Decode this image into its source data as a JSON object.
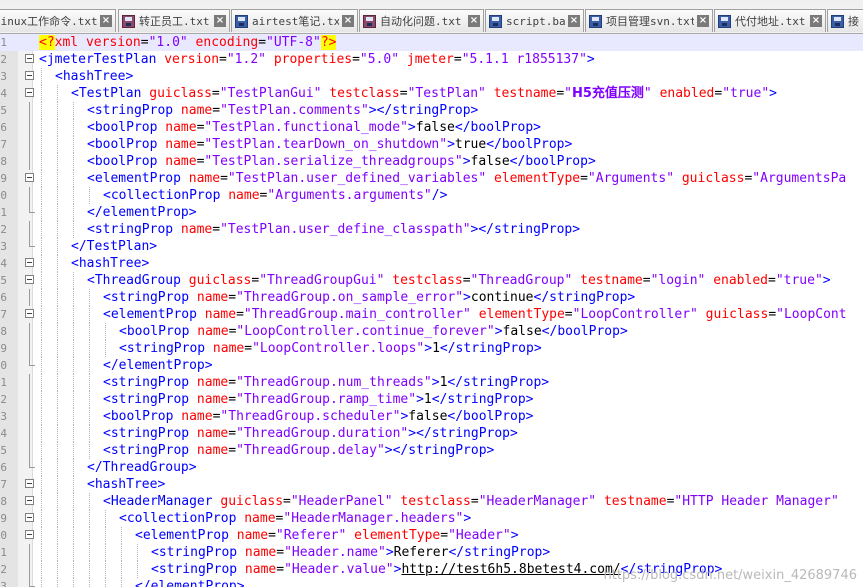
{
  "tabs": [
    {
      "label": "linux工作命令.txt",
      "modified": false
    },
    {
      "label": "转正员工.txt",
      "modified": true
    },
    {
      "label": "airtest笔记.txt",
      "modified": false
    },
    {
      "label": "自动化问题.txt",
      "modified": true
    },
    {
      "label": "script.bat",
      "modified": false
    },
    {
      "label": "项目管理svn.txt",
      "modified": false
    },
    {
      "label": "代付地址.txt",
      "modified": false
    },
    {
      "label": "接",
      "modified": false
    }
  ],
  "line_numbers": [
    "1",
    "2",
    "3",
    "4",
    "5",
    "6",
    "7",
    "8",
    "9",
    "0",
    "1",
    "2",
    "3",
    "4",
    "5",
    "6",
    "7",
    "8",
    "9",
    "0",
    "1",
    "2",
    "3",
    "4",
    "5",
    "6",
    "7",
    "8",
    "9",
    "0",
    "1",
    "2",
    "3"
  ],
  "fold_markers": [
    "none",
    "box",
    "box",
    "box",
    "line",
    "line",
    "line",
    "line",
    "box",
    "line",
    "end",
    "line",
    "end",
    "box",
    "box",
    "line",
    "box",
    "line",
    "line",
    "end",
    "line",
    "line",
    "line",
    "line",
    "line",
    "end",
    "box",
    "box",
    "box",
    "box",
    "line",
    "line",
    "end"
  ],
  "lines": [
    {
      "indent": 0,
      "tokens": [
        [
          "pi",
          "<?"
        ],
        [
          "pi-name",
          "xml"
        ],
        [
          "attr",
          " version"
        ],
        [
          "text",
          "="
        ],
        [
          "val",
          "\"1.0\""
        ],
        [
          "attr",
          " encoding"
        ],
        [
          "text",
          "="
        ],
        [
          "val",
          "\"UTF-8\""
        ],
        [
          "pi",
          "?>"
        ]
      ]
    },
    {
      "indent": 0,
      "tokens": [
        [
          "tag",
          "<jmeterTestPlan"
        ],
        [
          "attr",
          " version"
        ],
        [
          "text",
          "="
        ],
        [
          "val",
          "\"1.2\""
        ],
        [
          "attr",
          " properties"
        ],
        [
          "text",
          "="
        ],
        [
          "val",
          "\"5.0\""
        ],
        [
          "attr",
          " jmeter"
        ],
        [
          "text",
          "="
        ],
        [
          "val",
          "\"5.1.1 r1855137\""
        ],
        [
          "tag",
          ">"
        ]
      ]
    },
    {
      "indent": 1,
      "tokens": [
        [
          "tag",
          "<hashTree>"
        ]
      ]
    },
    {
      "indent": 2,
      "tokens": [
        [
          "tag",
          "<TestPlan"
        ],
        [
          "attr",
          " guiclass"
        ],
        [
          "text",
          "="
        ],
        [
          "val",
          "\"TestPlanGui\""
        ],
        [
          "attr",
          " testclass"
        ],
        [
          "text",
          "="
        ],
        [
          "val",
          "\"TestPlan\""
        ],
        [
          "attr",
          " testname"
        ],
        [
          "text",
          "="
        ],
        [
          "val",
          "\""
        ],
        [
          "val-cjk",
          "H5充值压测"
        ],
        [
          "val",
          "\""
        ],
        [
          "attr",
          " enabled"
        ],
        [
          "text",
          "="
        ],
        [
          "val",
          "\"true\""
        ],
        [
          "tag",
          ">"
        ]
      ]
    },
    {
      "indent": 3,
      "tokens": [
        [
          "tag",
          "<stringProp"
        ],
        [
          "attr",
          " name"
        ],
        [
          "text",
          "="
        ],
        [
          "val",
          "\"TestPlan.comments\""
        ],
        [
          "tag",
          "></stringProp>"
        ]
      ]
    },
    {
      "indent": 3,
      "tokens": [
        [
          "tag",
          "<boolProp"
        ],
        [
          "attr",
          " name"
        ],
        [
          "text",
          "="
        ],
        [
          "val",
          "\"TestPlan.functional_mode\""
        ],
        [
          "tag",
          ">"
        ],
        [
          "text",
          "false"
        ],
        [
          "tag",
          "</boolProp>"
        ]
      ]
    },
    {
      "indent": 3,
      "tokens": [
        [
          "tag",
          "<boolProp"
        ],
        [
          "attr",
          " name"
        ],
        [
          "text",
          "="
        ],
        [
          "val",
          "\"TestPlan.tearDown_on_shutdown\""
        ],
        [
          "tag",
          ">"
        ],
        [
          "text",
          "true"
        ],
        [
          "tag",
          "</boolProp>"
        ]
      ]
    },
    {
      "indent": 3,
      "tokens": [
        [
          "tag",
          "<boolProp"
        ],
        [
          "attr",
          " name"
        ],
        [
          "text",
          "="
        ],
        [
          "val",
          "\"TestPlan.serialize_threadgroups\""
        ],
        [
          "tag",
          ">"
        ],
        [
          "text",
          "false"
        ],
        [
          "tag",
          "</boolProp>"
        ]
      ]
    },
    {
      "indent": 3,
      "tokens": [
        [
          "tag",
          "<elementProp"
        ],
        [
          "attr",
          " name"
        ],
        [
          "text",
          "="
        ],
        [
          "val",
          "\"TestPlan.user_defined_variables\""
        ],
        [
          "attr",
          " elementType"
        ],
        [
          "text",
          "="
        ],
        [
          "val",
          "\"Arguments\""
        ],
        [
          "attr",
          " guiclass"
        ],
        [
          "text",
          "="
        ],
        [
          "val",
          "\"ArgumentsPa"
        ]
      ]
    },
    {
      "indent": 4,
      "tokens": [
        [
          "tag",
          "<collectionProp"
        ],
        [
          "attr",
          " name"
        ],
        [
          "text",
          "="
        ],
        [
          "val",
          "\"Arguments.arguments\""
        ],
        [
          "tag",
          "/>"
        ]
      ]
    },
    {
      "indent": 3,
      "tokens": [
        [
          "tag",
          "</elementProp>"
        ]
      ]
    },
    {
      "indent": 3,
      "tokens": [
        [
          "tag",
          "<stringProp"
        ],
        [
          "attr",
          " name"
        ],
        [
          "text",
          "="
        ],
        [
          "val",
          "\"TestPlan.user_define_classpath\""
        ],
        [
          "tag",
          "></stringProp>"
        ]
      ]
    },
    {
      "indent": 2,
      "tokens": [
        [
          "tag",
          "</TestPlan>"
        ]
      ]
    },
    {
      "indent": 2,
      "tokens": [
        [
          "tag",
          "<hashTree>"
        ]
      ]
    },
    {
      "indent": 3,
      "tokens": [
        [
          "tag",
          "<ThreadGroup"
        ],
        [
          "attr",
          " guiclass"
        ],
        [
          "text",
          "="
        ],
        [
          "val",
          "\"ThreadGroupGui\""
        ],
        [
          "attr",
          " testclass"
        ],
        [
          "text",
          "="
        ],
        [
          "val",
          "\"ThreadGroup\""
        ],
        [
          "attr",
          " testname"
        ],
        [
          "text",
          "="
        ],
        [
          "val",
          "\"login\""
        ],
        [
          "attr",
          " enabled"
        ],
        [
          "text",
          "="
        ],
        [
          "val",
          "\"true\""
        ],
        [
          "tag",
          ">"
        ]
      ]
    },
    {
      "indent": 4,
      "tokens": [
        [
          "tag",
          "<stringProp"
        ],
        [
          "attr",
          " name"
        ],
        [
          "text",
          "="
        ],
        [
          "val",
          "\"ThreadGroup.on_sample_error\""
        ],
        [
          "tag",
          ">"
        ],
        [
          "text",
          "continue"
        ],
        [
          "tag",
          "</stringProp>"
        ]
      ]
    },
    {
      "indent": 4,
      "tokens": [
        [
          "tag",
          "<elementProp"
        ],
        [
          "attr",
          " name"
        ],
        [
          "text",
          "="
        ],
        [
          "val",
          "\"ThreadGroup.main_controller\""
        ],
        [
          "attr",
          " elementType"
        ],
        [
          "text",
          "="
        ],
        [
          "val",
          "\"LoopController\""
        ],
        [
          "attr",
          " guiclass"
        ],
        [
          "text",
          "="
        ],
        [
          "val",
          "\"LoopCont"
        ]
      ]
    },
    {
      "indent": 5,
      "tokens": [
        [
          "tag",
          "<boolProp"
        ],
        [
          "attr",
          " name"
        ],
        [
          "text",
          "="
        ],
        [
          "val",
          "\"LoopController.continue_forever\""
        ],
        [
          "tag",
          ">"
        ],
        [
          "text",
          "false"
        ],
        [
          "tag",
          "</boolProp>"
        ]
      ]
    },
    {
      "indent": 5,
      "tokens": [
        [
          "tag",
          "<stringProp"
        ],
        [
          "attr",
          " name"
        ],
        [
          "text",
          "="
        ],
        [
          "val",
          "\"LoopController.loops\""
        ],
        [
          "tag",
          ">"
        ],
        [
          "text",
          "1"
        ],
        [
          "tag",
          "</stringProp>"
        ]
      ]
    },
    {
      "indent": 4,
      "tokens": [
        [
          "tag",
          "</elementProp>"
        ]
      ]
    },
    {
      "indent": 4,
      "tokens": [
        [
          "tag",
          "<stringProp"
        ],
        [
          "attr",
          " name"
        ],
        [
          "text",
          "="
        ],
        [
          "val",
          "\"ThreadGroup.num_threads\""
        ],
        [
          "tag",
          ">"
        ],
        [
          "text",
          "1"
        ],
        [
          "tag",
          "</stringProp>"
        ]
      ]
    },
    {
      "indent": 4,
      "tokens": [
        [
          "tag",
          "<stringProp"
        ],
        [
          "attr",
          " name"
        ],
        [
          "text",
          "="
        ],
        [
          "val",
          "\"ThreadGroup.ramp_time\""
        ],
        [
          "tag",
          ">"
        ],
        [
          "text",
          "1"
        ],
        [
          "tag",
          "</stringProp>"
        ]
      ]
    },
    {
      "indent": 4,
      "tokens": [
        [
          "tag",
          "<boolProp"
        ],
        [
          "attr",
          " name"
        ],
        [
          "text",
          "="
        ],
        [
          "val",
          "\"ThreadGroup.scheduler\""
        ],
        [
          "tag",
          ">"
        ],
        [
          "text",
          "false"
        ],
        [
          "tag",
          "</boolProp>"
        ]
      ]
    },
    {
      "indent": 4,
      "tokens": [
        [
          "tag",
          "<stringProp"
        ],
        [
          "attr",
          " name"
        ],
        [
          "text",
          "="
        ],
        [
          "val",
          "\"ThreadGroup.duration\""
        ],
        [
          "tag",
          "></stringProp>"
        ]
      ]
    },
    {
      "indent": 4,
      "tokens": [
        [
          "tag",
          "<stringProp"
        ],
        [
          "attr",
          " name"
        ],
        [
          "text",
          "="
        ],
        [
          "val",
          "\"ThreadGroup.delay\""
        ],
        [
          "tag",
          "></stringProp>"
        ]
      ]
    },
    {
      "indent": 3,
      "tokens": [
        [
          "tag",
          "</ThreadGroup>"
        ]
      ]
    },
    {
      "indent": 3,
      "tokens": [
        [
          "tag",
          "<hashTree>"
        ]
      ]
    },
    {
      "indent": 4,
      "tokens": [
        [
          "tag",
          "<HeaderManager"
        ],
        [
          "attr",
          " guiclass"
        ],
        [
          "text",
          "="
        ],
        [
          "val",
          "\"HeaderPanel\""
        ],
        [
          "attr",
          " testclass"
        ],
        [
          "text",
          "="
        ],
        [
          "val",
          "\"HeaderManager\""
        ],
        [
          "attr",
          " testname"
        ],
        [
          "text",
          "="
        ],
        [
          "val",
          "\"HTTP Header Manager\""
        ]
      ]
    },
    {
      "indent": 5,
      "tokens": [
        [
          "tag",
          "<collectionProp"
        ],
        [
          "attr",
          " name"
        ],
        [
          "text",
          "="
        ],
        [
          "val",
          "\"HeaderManager.headers\""
        ],
        [
          "tag",
          ">"
        ]
      ]
    },
    {
      "indent": 6,
      "tokens": [
        [
          "tag",
          "<elementProp"
        ],
        [
          "attr",
          " name"
        ],
        [
          "text",
          "="
        ],
        [
          "val",
          "\"Referer\""
        ],
        [
          "attr",
          " elementType"
        ],
        [
          "text",
          "="
        ],
        [
          "val",
          "\"Header\""
        ],
        [
          "tag",
          ">"
        ]
      ]
    },
    {
      "indent": 7,
      "tokens": [
        [
          "tag",
          "<stringProp"
        ],
        [
          "attr",
          " name"
        ],
        [
          "text",
          "="
        ],
        [
          "val",
          "\"Header.name\""
        ],
        [
          "tag",
          ">"
        ],
        [
          "text",
          "Referer"
        ],
        [
          "tag",
          "</stringProp>"
        ]
      ]
    },
    {
      "indent": 7,
      "tokens": [
        [
          "tag",
          "<stringProp"
        ],
        [
          "attr",
          " name"
        ],
        [
          "text",
          "="
        ],
        [
          "val",
          "\"Header.value\""
        ],
        [
          "tag",
          ">"
        ],
        [
          "url",
          "http://test6h5.8betest4.com/"
        ],
        [
          "tag",
          "</stringProp>"
        ]
      ]
    },
    {
      "indent": 6,
      "tokens": [
        [
          "tag",
          "</elementProp>"
        ]
      ]
    }
  ],
  "watermark": "https://blog.csdn.net/weixin_42689746",
  "colors": {
    "tag": "#0000ff",
    "attribute": "#ff0000",
    "value": "#8000ff",
    "text": "#000000",
    "pi_highlight": "#ffff00",
    "current_line": "#e8e8ff"
  }
}
